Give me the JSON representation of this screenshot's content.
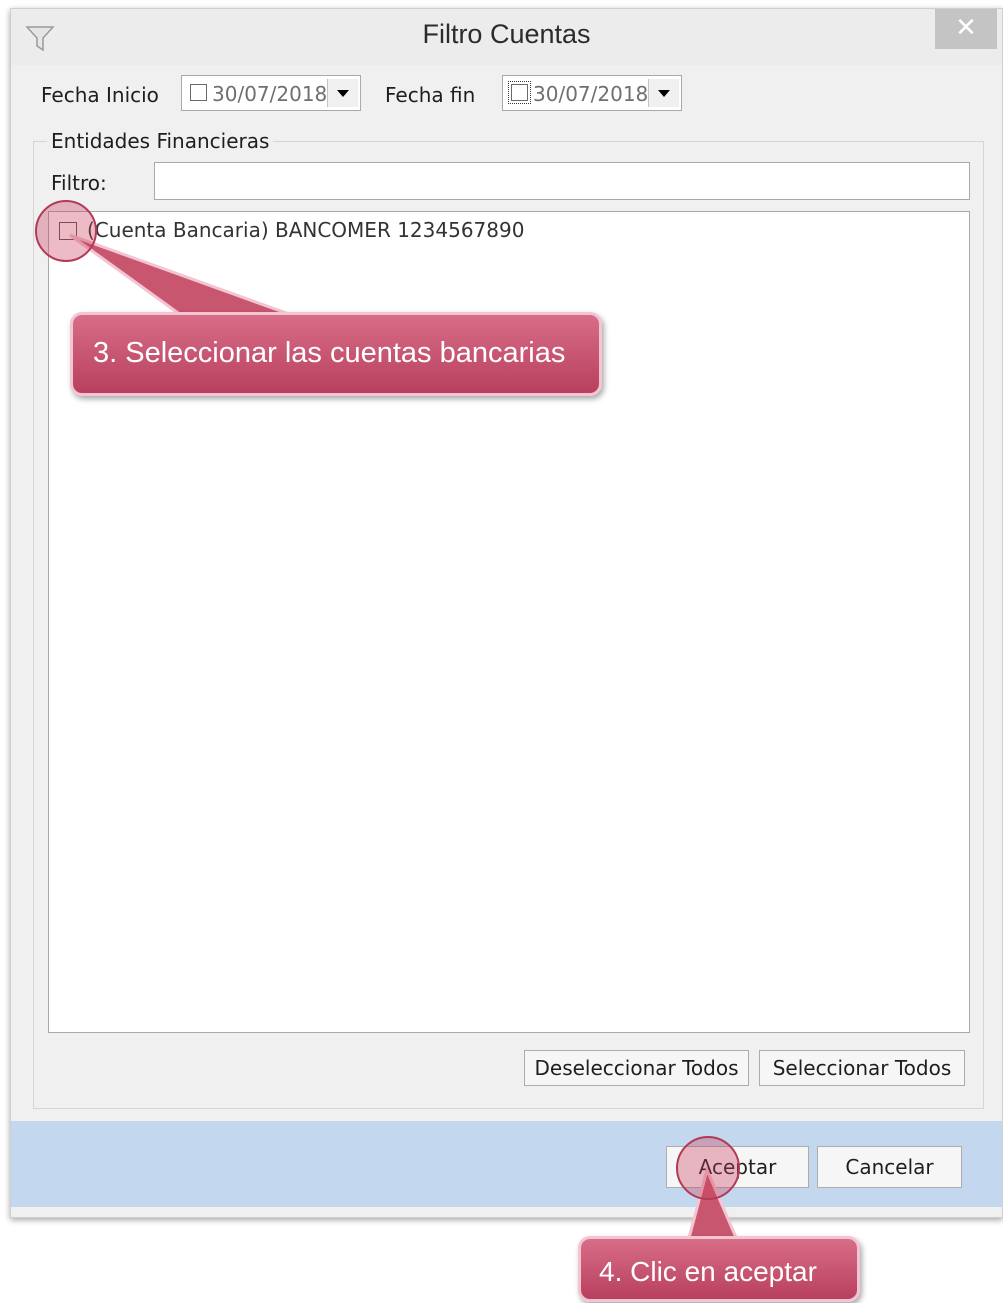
{
  "window": {
    "title": "Filtro Cuentas",
    "close_symbol": "✕"
  },
  "dates": {
    "start_label": "Fecha Inicio",
    "start_value": "30/07/2018",
    "end_label": "Fecha fin",
    "end_value": "30/07/2018"
  },
  "group": {
    "legend": "Entidades Financieras",
    "filter_label": "Filtro:",
    "filter_value": "",
    "items": [
      {
        "label": "(Cuenta Bancaria) BANCOMER 1234567890",
        "checked": false
      }
    ],
    "deselect_all_label": "Deseleccionar Todos",
    "select_all_label": "Seleccionar Todos"
  },
  "footer": {
    "accept_label": "Aceptar",
    "cancel_label": "Cancelar"
  },
  "callouts": {
    "step3": "3. Seleccionar las cuentas bancarias",
    "step4": "4. Clic en aceptar"
  },
  "icons": {
    "title": "filter-icon",
    "close": "close-icon",
    "dropdown": "chevron-down-icon"
  },
  "colors": {
    "footer_bg": "#c3d8ee",
    "callout": "#c84a68"
  }
}
